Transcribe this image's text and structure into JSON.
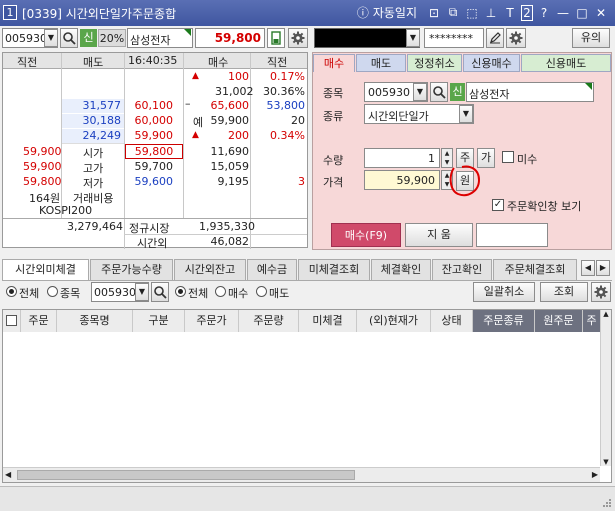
{
  "window": {
    "number": "1",
    "title": "[0339] 시간외단일가주문종합",
    "autolog": "자동일지",
    "title_icons": [
      "layout-icon",
      "restore-window-icon",
      "copy-icon",
      "pin-icon",
      "text-size-icon",
      "two-icon",
      "help-icon",
      "minimize-icon",
      "maximize-icon",
      "close-icon"
    ],
    "title_glyphs": [
      "⊡",
      "⧉",
      "⬚",
      "⊥",
      "T",
      "2",
      "?",
      "—",
      "□",
      "✕"
    ]
  },
  "quote": {
    "stock_code": "005930",
    "credit_badge": "신",
    "margin_rate": "20%",
    "stock_name": "삼성전자",
    "current_price": "59,800",
    "headers": [
      "직전",
      "매도",
      "16:40:35",
      "매수",
      "직전"
    ],
    "ask_rows": [
      {
        "prev": "",
        "volume": "",
        "price": "",
        "marker": "▲",
        "bid_vol": "100",
        "pct": "0.17%",
        "pct_color": "red"
      },
      {
        "prev": "",
        "volume": "",
        "price": "",
        "marker": "",
        "bid_vol": "31,002",
        "pct": "30.36%",
        "pct_color": "black"
      },
      {
        "prev": "",
        "volume": "31,577",
        "price": "60,100",
        "marker": "–",
        "bid_vol": "65,600",
        "pct": "53,800",
        "pct_color": "blue"
      },
      {
        "prev": "",
        "volume": "30,188",
        "price": "60,000",
        "marker": "예",
        "bid_vol": "59,900",
        "pct": "20",
        "pct_color": "black"
      },
      {
        "prev": "",
        "volume": "24,249",
        "price": "59,900",
        "marker": "▲",
        "bid_vol": "200",
        "pct": "0.34%",
        "pct_color": "red"
      }
    ],
    "info_rows": [
      {
        "value": "59,900",
        "label": "시가",
        "price": "59,800",
        "bid": "11,690",
        "right": ""
      },
      {
        "value": "59,900",
        "label": "고가",
        "price": "59,700",
        "bid": "15,059",
        "right": ""
      },
      {
        "value": "59,800",
        "label": "저가",
        "price": "59,600",
        "bid": "9,195",
        "right": "3"
      },
      {
        "value": "164원",
        "label": "거래비용",
        "price": "",
        "bid": "",
        "right": ""
      },
      {
        "value": "KOSPI200",
        "label": "",
        "price": "",
        "bid": "",
        "right": ""
      }
    ],
    "total_volume": "3,279,464",
    "regular_market_label": "정규시장",
    "regular_market_value": "1,935,330",
    "after_hours_label": "시간외",
    "after_hours_value": "46,082"
  },
  "account": {
    "password": "********",
    "notice_button": "유의"
  },
  "order_tabs": [
    "매수",
    "매도",
    "정정취소",
    "신용매수",
    "신용매도"
  ],
  "order_form": {
    "stock_label": "종목",
    "stock_code": "005930",
    "credit_badge": "신",
    "stock_name": "삼성전자",
    "type_label": "종류",
    "type_value": "시간외단일가",
    "qty_label": "수량",
    "qty_value": "1",
    "qty_share_btn": "주",
    "qty_price_btn": "가",
    "unpaid_label": "미수",
    "price_label": "가격",
    "price_value": "59,900",
    "price_won_btn": "원",
    "confirm_label": "주문확인창 보기",
    "buy_button": "매수(F9)",
    "clear_button": "지 움"
  },
  "bottom_tabs": [
    "시간외미체결",
    "주문가능수량",
    "시간외잔고",
    "예수금",
    "미체결조회",
    "체결확인",
    "잔고확인",
    "주문체결조회"
  ],
  "filter": {
    "all_label": "전체",
    "stock_label": "종목",
    "stock_code": "005930",
    "all2_label": "전체",
    "buy_label": "매수",
    "sell_label": "매도",
    "cancel_all_button": "일괄취소",
    "query_button": "조회"
  },
  "columns": [
    "주문",
    "종목명",
    "구분",
    "주문가",
    "주문량",
    "미체결",
    "(외)현재가",
    "상태",
    "주문종류",
    "원주문",
    "주"
  ],
  "colors": {
    "title_bar": "#4a60aa",
    "buy_panel": "#f7d8d8",
    "buy_button": "#d04a6a",
    "accent_red": "#d40000",
    "accent_blue": "#1a3fc0"
  }
}
